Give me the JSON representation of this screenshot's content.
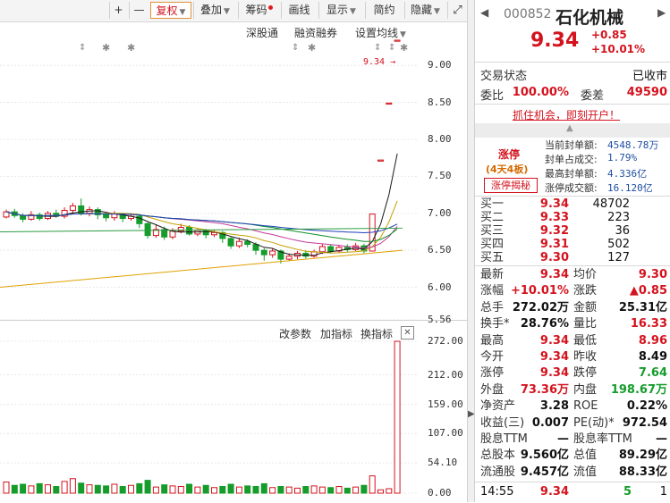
{
  "toolbar": {
    "plus": "+",
    "minus": "—",
    "restore_rights": "复权",
    "overlay": "叠加",
    "chip": "筹码",
    "draw_line": "画线",
    "display": "显示",
    "brief": "简约",
    "hide": "隐藏"
  },
  "chart_header": {
    "link1": "深股通",
    "link2": "融资融券",
    "settings": "设置均线"
  },
  "price_axis": [
    "9.00",
    "8.50",
    "8.00",
    "7.50",
    "7.00",
    "6.50",
    "6.00",
    "5.56"
  ],
  "price_marker": "9.34",
  "volume_header": {
    "change_params": "改参数",
    "add_indicator": "加指标",
    "switch_indicator": "换指标"
  },
  "volume_axis": [
    "272.00",
    "212.00",
    "159.00",
    "107.00",
    "54.10",
    "0.00"
  ],
  "chart_data": {
    "type": "candlestick",
    "candles": [
      {
        "o": 6.95,
        "c": 7.02,
        "h": 7.05,
        "l": 6.93
      },
      {
        "o": 7.02,
        "c": 6.97,
        "h": 7.06,
        "l": 6.94
      },
      {
        "o": 6.97,
        "c": 6.92,
        "h": 7.0,
        "l": 6.88
      },
      {
        "o": 6.92,
        "c": 6.98,
        "h": 7.03,
        "l": 6.9
      },
      {
        "o": 6.98,
        "c": 6.93,
        "h": 7.01,
        "l": 6.9
      },
      {
        "o": 6.93,
        "c": 7.0,
        "h": 7.03,
        "l": 6.91
      },
      {
        "o": 7.0,
        "c": 6.96,
        "h": 7.05,
        "l": 6.94
      },
      {
        "o": 6.96,
        "c": 7.04,
        "h": 7.08,
        "l": 6.93
      },
      {
        "o": 7.04,
        "c": 7.1,
        "h": 7.14,
        "l": 6.99
      },
      {
        "o": 7.1,
        "c": 7.0,
        "h": 7.2,
        "l": 6.97
      },
      {
        "o": 7.0,
        "c": 7.05,
        "h": 7.09,
        "l": 6.96
      },
      {
        "o": 7.05,
        "c": 6.98,
        "h": 7.08,
        "l": 6.92
      },
      {
        "o": 6.98,
        "c": 6.94,
        "h": 7.01,
        "l": 6.89
      },
      {
        "o": 6.94,
        "c": 6.99,
        "h": 7.03,
        "l": 6.9
      },
      {
        "o": 6.99,
        "c": 6.93,
        "h": 7.01,
        "l": 6.88
      },
      {
        "o": 6.93,
        "c": 6.96,
        "h": 7.0,
        "l": 6.9
      },
      {
        "o": 6.96,
        "c": 6.86,
        "h": 6.99,
        "l": 6.8
      },
      {
        "o": 6.86,
        "c": 6.7,
        "h": 6.88,
        "l": 6.66
      },
      {
        "o": 6.7,
        "c": 6.78,
        "h": 6.84,
        "l": 6.67
      },
      {
        "o": 6.78,
        "c": 6.68,
        "h": 6.82,
        "l": 6.64
      },
      {
        "o": 6.68,
        "c": 6.76,
        "h": 6.8,
        "l": 6.65
      },
      {
        "o": 6.76,
        "c": 6.81,
        "h": 6.86,
        "l": 6.73
      },
      {
        "o": 6.81,
        "c": 6.72,
        "h": 6.84,
        "l": 6.7
      },
      {
        "o": 6.72,
        "c": 6.77,
        "h": 6.8,
        "l": 6.69
      },
      {
        "o": 6.77,
        "c": 6.71,
        "h": 6.79,
        "l": 6.66
      },
      {
        "o": 6.71,
        "c": 6.74,
        "h": 6.78,
        "l": 6.68
      },
      {
        "o": 6.74,
        "c": 6.66,
        "h": 6.76,
        "l": 6.6
      },
      {
        "o": 6.66,
        "c": 6.56,
        "h": 6.68,
        "l": 6.52
      },
      {
        "o": 6.56,
        "c": 6.62,
        "h": 6.67,
        "l": 6.53
      },
      {
        "o": 6.62,
        "c": 6.58,
        "h": 6.65,
        "l": 6.54
      },
      {
        "o": 6.58,
        "c": 6.5,
        "h": 6.61,
        "l": 6.44
      },
      {
        "o": 6.5,
        "c": 6.44,
        "h": 6.53,
        "l": 6.36
      },
      {
        "o": 6.44,
        "c": 6.49,
        "h": 6.52,
        "l": 6.4
      },
      {
        "o": 6.49,
        "c": 6.38,
        "h": 6.51,
        "l": 6.32
      },
      {
        "o": 6.38,
        "c": 6.42,
        "h": 6.46,
        "l": 6.36
      },
      {
        "o": 6.42,
        "c": 6.46,
        "h": 6.49,
        "l": 6.38
      },
      {
        "o": 6.46,
        "c": 6.42,
        "h": 6.5,
        "l": 6.39
      },
      {
        "o": 6.42,
        "c": 6.48,
        "h": 6.51,
        "l": 6.4
      },
      {
        "o": 6.48,
        "c": 6.55,
        "h": 6.58,
        "l": 6.45
      },
      {
        "o": 6.55,
        "c": 6.49,
        "h": 6.58,
        "l": 6.46
      },
      {
        "o": 6.49,
        "c": 6.54,
        "h": 6.57,
        "l": 6.47
      },
      {
        "o": 6.54,
        "c": 6.51,
        "h": 6.58,
        "l": 6.48
      },
      {
        "o": 6.51,
        "c": 6.56,
        "h": 6.6,
        "l": 6.49
      },
      {
        "o": 6.56,
        "c": 6.49,
        "h": 6.59,
        "l": 6.46
      },
      {
        "o": 6.49,
        "c": 6.99,
        "h": 6.99,
        "l": 6.49
      },
      {
        "o": 7.72,
        "c": 7.72,
        "h": 7.72,
        "l": 7.72
      },
      {
        "o": 8.49,
        "c": 8.49,
        "h": 8.49,
        "l": 8.49
      },
      {
        "o": 9.34,
        "c": 9.34,
        "h": 9.34,
        "l": 9.34
      }
    ],
    "volumes": [
      20,
      14,
      16,
      13,
      17,
      15,
      12,
      21,
      26,
      18,
      15,
      14,
      13,
      16,
      12,
      14,
      17,
      23,
      11,
      15,
      13,
      12,
      16,
      11,
      14,
      10,
      12,
      16,
      11,
      13,
      12,
      17,
      10,
      12,
      11,
      9,
      12,
      13,
      11,
      10,
      12,
      9,
      11,
      14,
      31,
      6,
      8,
      272
    ],
    "y_range": [
      5.56,
      9.4
    ],
    "vol_range": [
      0,
      272
    ]
  },
  "quote": {
    "code": "000852",
    "name": "石化机械",
    "price": "9.34",
    "change": "+0.85",
    "change_pct": "+10.01%"
  },
  "status": {
    "label": "交易状态",
    "value": "已收市"
  },
  "ratio": {
    "label1": "委比",
    "value1": "100.00%",
    "label2": "委差",
    "value2": "49590"
  },
  "promo": "抓住机会，即刻开户！",
  "limit_up": {
    "title": "涨停",
    "streak": "(4天4板)",
    "reveal_button": "涨停揭秘",
    "items": [
      {
        "label": "当前封单额:",
        "value": "4548.78万"
      },
      {
        "label": "封单占成交:",
        "value": "1.79%"
      },
      {
        "label": "最高封单额:",
        "value": "4.336亿"
      },
      {
        "label": "涨停成交额:",
        "value": "16.120亿"
      }
    ]
  },
  "bids": [
    {
      "label": "买一",
      "price": "9.34",
      "vol": "48702"
    },
    {
      "label": "买二",
      "price": "9.33",
      "vol": "223"
    },
    {
      "label": "买三",
      "price": "9.32",
      "vol": "36"
    },
    {
      "label": "买四",
      "price": "9.31",
      "vol": "502"
    },
    {
      "label": "买五",
      "price": "9.30",
      "vol": "127"
    }
  ],
  "stats": [
    {
      "l1": "最新",
      "v1": "9.34",
      "c1": "red",
      "l2": "均价",
      "v2": "9.30",
      "c2": "red"
    },
    {
      "l1": "涨幅",
      "v1": "+10.01%",
      "c1": "red",
      "l2": "涨跌",
      "v2": "▲0.85",
      "c2": "red"
    },
    {
      "l1": "总手",
      "v1": "272.02万",
      "c1": "dark",
      "l2": "金额",
      "v2": "25.31亿",
      "c2": "dark"
    },
    {
      "l1": "换手*",
      "v1": "28.76%",
      "c1": "dark",
      "l2": "量比",
      "v2": "16.33",
      "c2": "red"
    },
    {
      "l1": "最高",
      "v1": "9.34",
      "c1": "red",
      "l2": "最低",
      "v2": "8.96",
      "c2": "red"
    },
    {
      "l1": "今开",
      "v1": "9.34",
      "c1": "red",
      "l2": "昨收",
      "v2": "8.49",
      "c2": "dark"
    },
    {
      "l1": "涨停",
      "v1": "9.34",
      "c1": "red",
      "l2": "跌停",
      "v2": "7.64",
      "c2": "green"
    },
    {
      "l1": "外盘",
      "v1": "73.36万",
      "c1": "red",
      "l2": "内盘",
      "v2": "198.67万",
      "c2": "green"
    },
    {
      "l1": "净资产",
      "v1": "3.28",
      "c1": "dark",
      "l2": "ROE",
      "v2": "0.22%",
      "c2": "dark"
    },
    {
      "l1": "收益(三)",
      "v1": "0.007",
      "c1": "dark",
      "l2": "PE(动)*",
      "v2": "972.54",
      "c2": "dark"
    },
    {
      "l1": "股息TTM",
      "v1": "—",
      "c1": "dark",
      "l2": "股息率TTM",
      "v2": "—",
      "c2": "dark"
    },
    {
      "l1": "总股本",
      "v1": "9.560亿",
      "c1": "dark",
      "l2": "总值",
      "v2": "89.29亿",
      "c2": "dark"
    },
    {
      "l1": "流通股",
      "v1": "9.457亿",
      "c1": "dark",
      "l2": "流值",
      "v2": "88.33亿",
      "c2": "dark"
    }
  ],
  "tick": {
    "time": "14:55",
    "price": "9.34",
    "vol": "5",
    "count": "1"
  },
  "colors": {
    "up": "#d4131e",
    "down": "#159c2b",
    "accent": "#e0913a"
  }
}
